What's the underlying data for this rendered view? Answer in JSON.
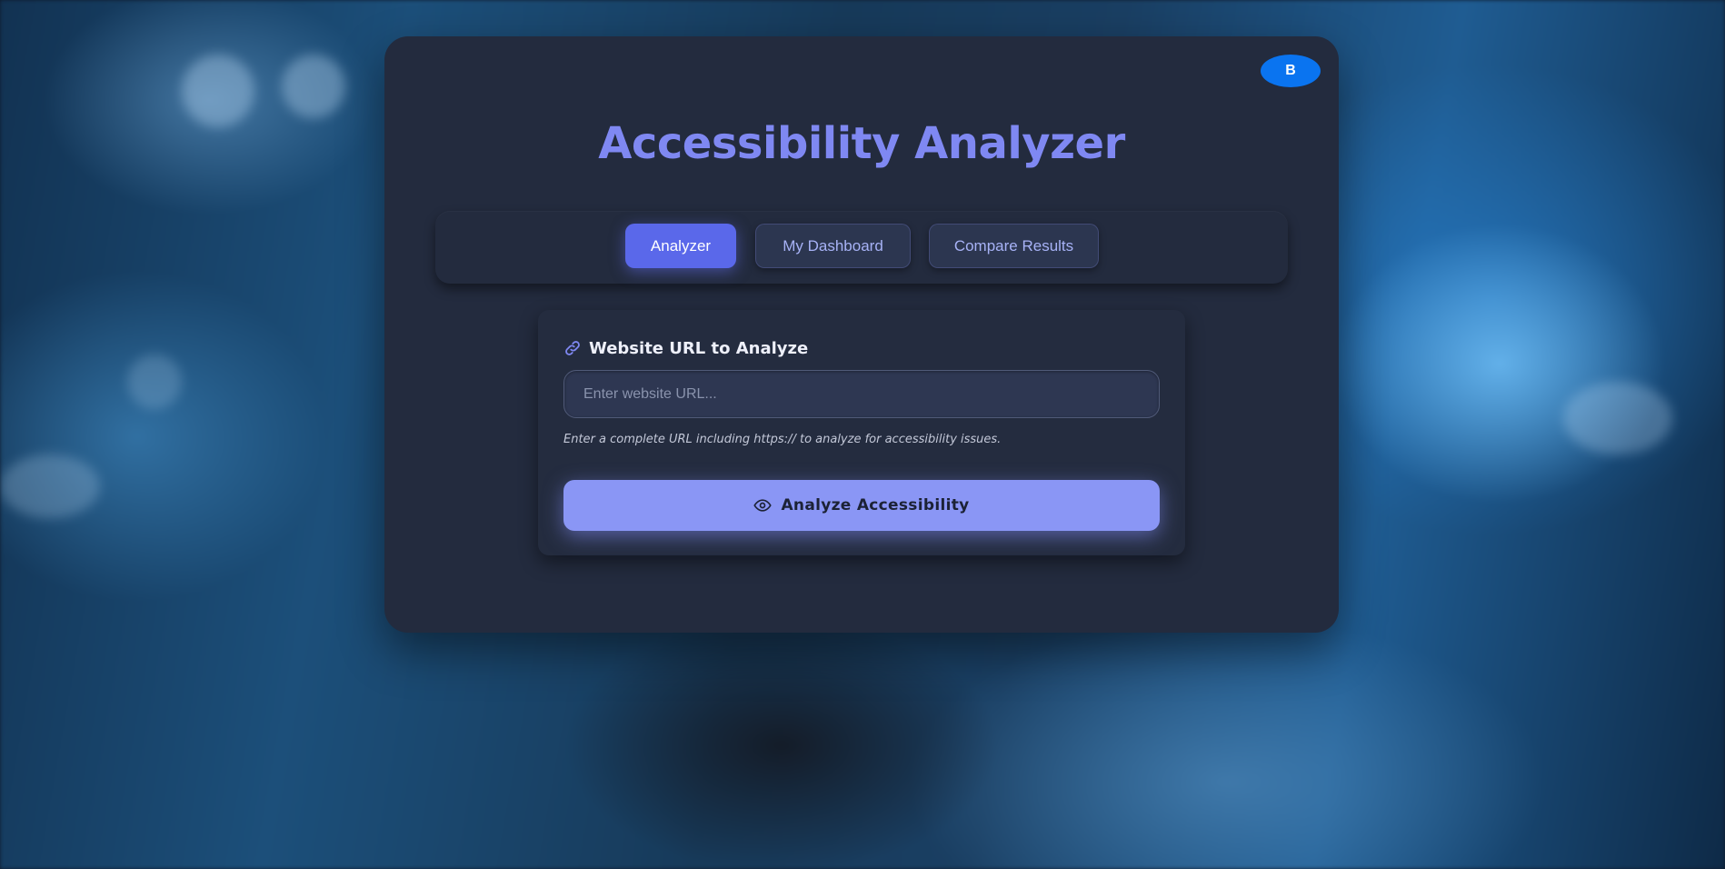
{
  "app": {
    "title": "Accessibility Analyzer",
    "user_initial": "B"
  },
  "tabs": [
    {
      "label": "Analyzer",
      "active": true
    },
    {
      "label": "My Dashboard",
      "active": false
    },
    {
      "label": "Compare Results",
      "active": false
    }
  ],
  "form": {
    "label": "Website URL to Analyze",
    "label_icon": "link-icon",
    "input_value": "",
    "input_placeholder": "Enter website URL...",
    "hint": "Enter a complete URL including https:// to analyze for accessibility issues.",
    "submit_label": "Analyze Accessibility",
    "submit_icon": "eye-icon"
  },
  "colors": {
    "accent": "#7f88f2",
    "active_tab": "#5a68ea",
    "button": "#8a96f5",
    "avatar": "#0a74f0",
    "card": "#232b3e"
  }
}
